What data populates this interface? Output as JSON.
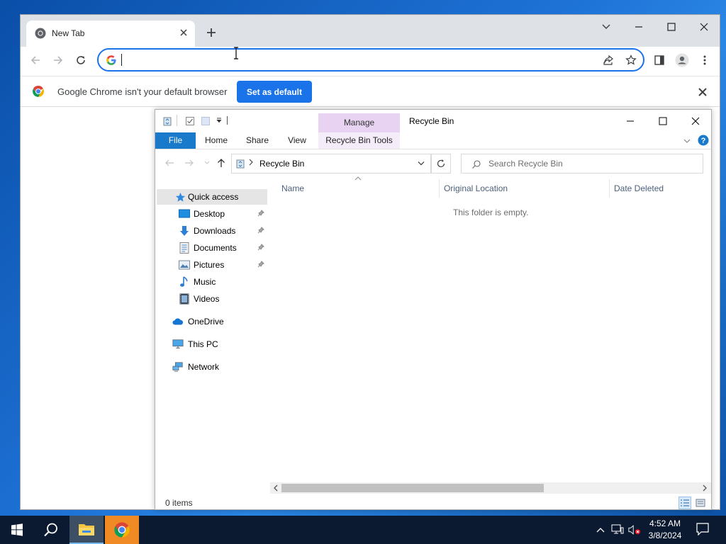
{
  "chrome": {
    "tab_title": "New Tab",
    "omnibox_value": "",
    "infobar_text": "Google Chrome isn't your default browser",
    "set_default_label": "Set as default"
  },
  "explorer": {
    "window_title": "Recycle Bin",
    "manage_label": "Manage",
    "ribbon_tabs": [
      "File",
      "Home",
      "Share",
      "View",
      "Recycle Bin Tools"
    ],
    "breadcrumb": "Recycle Bin",
    "search_placeholder": "Search Recycle Bin",
    "nav": {
      "quick_access": "Quick access",
      "desktop": "Desktop",
      "downloads": "Downloads",
      "documents": "Documents",
      "pictures": "Pictures",
      "music": "Music",
      "videos": "Videos",
      "onedrive": "OneDrive",
      "this_pc": "This PC",
      "network": "Network"
    },
    "columns": [
      "Name",
      "Original Location",
      "Date Deleted"
    ],
    "empty_message": "This folder is empty.",
    "status_items": "0 items"
  },
  "taskbar": {
    "time": "4:52 AM",
    "date": "3/8/2024"
  },
  "colors": {
    "chrome_accent": "#1a73e8",
    "file_tab": "#1979ca",
    "manage_tab": "#e8d3f3",
    "taskbar": "#0b1a30",
    "desktop": "#1e72d6"
  }
}
